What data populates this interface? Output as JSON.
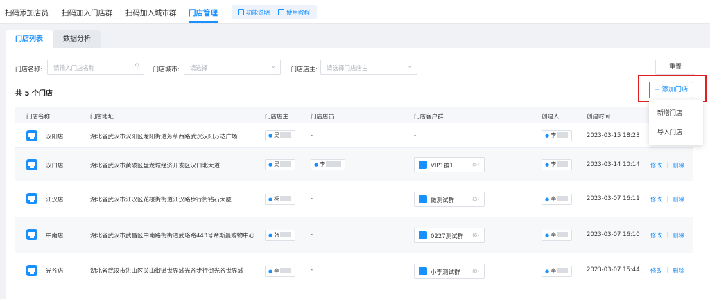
{
  "topnav": {
    "tabs": [
      {
        "label": "扫码添加店员"
      },
      {
        "label": "扫码加入门店群"
      },
      {
        "label": "扫码加入城市群"
      },
      {
        "label": "门店管理"
      }
    ],
    "help": {
      "feature": "功能说明",
      "tutorial": "使用教程"
    }
  },
  "subtabs": {
    "list": "门店列表",
    "analysis": "数据分析"
  },
  "filters": {
    "name_label": "门店名称:",
    "name_placeholder": "请输入门店名称",
    "city_label": "门店城市:",
    "city_placeholder": "请选择",
    "owner_label": "门店店主:",
    "owner_placeholder": "请选择门店店主",
    "reset": "重置"
  },
  "summary": {
    "count_text": "共 5 个门店"
  },
  "add_button": "+ 添加门店",
  "dropdown": {
    "items": [
      "新增门店",
      "导入门店"
    ]
  },
  "table": {
    "headers": [
      "门店名称",
      "门店地址",
      "门店店主",
      "门店店员",
      "门店客户群",
      "创建人",
      "创建时间"
    ],
    "rows": [
      {
        "name": "汉阳店",
        "address": "湖北省武汉市汉阳区龙阳街道芳草西路武汉汉阳万达广场",
        "owner": "吴",
        "staff": "-",
        "group": "-",
        "group_count": "",
        "creator": "李",
        "created": "2023-03-15 18:23"
      },
      {
        "name": "汉口店",
        "address": "湖北省武汉市黄陂区盘龙城经济开发区汉口北大道",
        "owner": "吴",
        "staff": "李",
        "group": "VIP1群1",
        "group_count": "(5)",
        "creator": "李",
        "created": "2023-03-14 10:14",
        "edit": "修改",
        "delete": "删除"
      },
      {
        "name": "江汉店",
        "address": "湖北省武汉市江汉区花楼街街道江汉路步行街钻石大厦",
        "owner": "杨",
        "staff": "-",
        "group": "做测试群",
        "group_count": "(3)",
        "creator": "李",
        "created": "2023-03-07 16:11",
        "edit": "修改",
        "delete": "删除"
      },
      {
        "name": "中南店",
        "address": "湖北省武汉市武昌区中南路街街道武珞路443号帝斯曼购物中心",
        "owner": "张",
        "staff": "-",
        "group": "0227测试群",
        "group_count": "(6)",
        "creator": "李",
        "created": "2023-03-07 16:10",
        "edit": "修改",
        "delete": "删除"
      },
      {
        "name": "光谷店",
        "address": "湖北省武汉市洪山区关山街道世界城光谷步行街光谷世界城",
        "owner": "李",
        "staff": "-",
        "group": "小李测试群",
        "group_count": "(8)",
        "creator": "李",
        "created": "2023-03-07 15:44",
        "edit": "修改",
        "delete": "删除"
      }
    ]
  },
  "colors": {
    "accent": "#1890ff",
    "highlight": "#e02020"
  }
}
